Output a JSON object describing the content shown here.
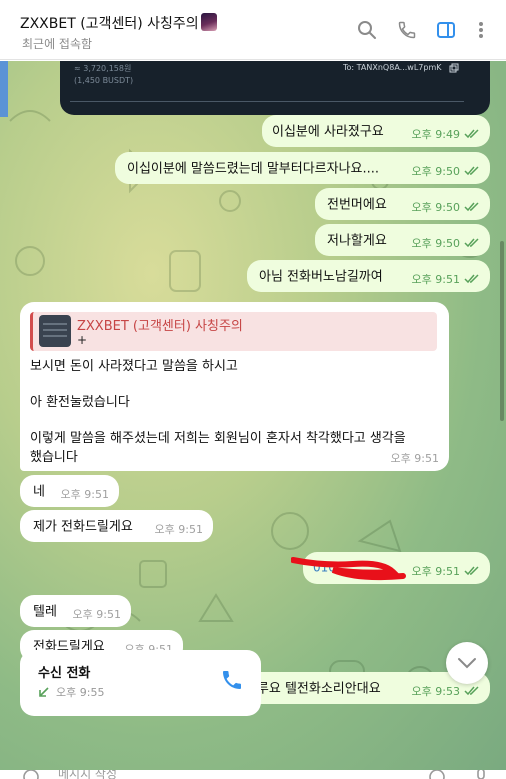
{
  "header": {
    "title": "ZXXBET (고객센터) 사칭주의",
    "subtitle": "최근에 접속함"
  },
  "card": {
    "line1": "≈ 3,720,158원",
    "line2": "(1,450 BUSDT)",
    "to": "To: TANXnQ8A...wL7pmK"
  },
  "messages_out_top": [
    {
      "text": "이십분에 사라졌구요",
      "time": "오후 9:49"
    },
    {
      "text": "이십이분에 말씀드렸는데 말부터다르자나요....",
      "time": "오후 9:50"
    },
    {
      "text": "전번머에요",
      "time": "오후 9:50"
    },
    {
      "text": "저나할게요",
      "time": "오후 9:50"
    },
    {
      "text": "아님 전화버노남길까여",
      "time": "오후 9:51"
    }
  ],
  "big_message": {
    "reply_name": "ZXXBET (고객센터) 사칭주의",
    "reply_text": "+",
    "line1": "보시면 돈이 사라졌다고 말씀을 하시고",
    "line2": "아 환전눌렀습니다",
    "line3": "이렇게 말씀을 해주셨는데 저희는 회원님이 혼자서 착각했다고 생각을",
    "line4": "했습니다",
    "time": "오후 9:51"
  },
  "messages_in": [
    {
      "text": "네",
      "time": "오후 9:51"
    },
    {
      "text": "제가 전화드릴게요",
      "time": "오후 9:51"
    },
    {
      "text": "텔레",
      "time": "오후 9:51"
    },
    {
      "text": "전화드릴게요",
      "time": "오후 9:51"
    }
  ],
  "phone_message": {
    "text": "010",
    "time": "오후 9:51"
  },
  "last_out": {
    "text": "전화루요 텔전화소리안대요",
    "time": "오후 9:53"
  },
  "call": {
    "title": "수신 전화",
    "time": "오후 9:55"
  },
  "input": {
    "placeholder": "메시지 작성"
  },
  "colors": {
    "accent": "#3390ec",
    "outgoing_bubble": "#effdde",
    "check": "#58a15a",
    "reply_name": "#c64545"
  }
}
